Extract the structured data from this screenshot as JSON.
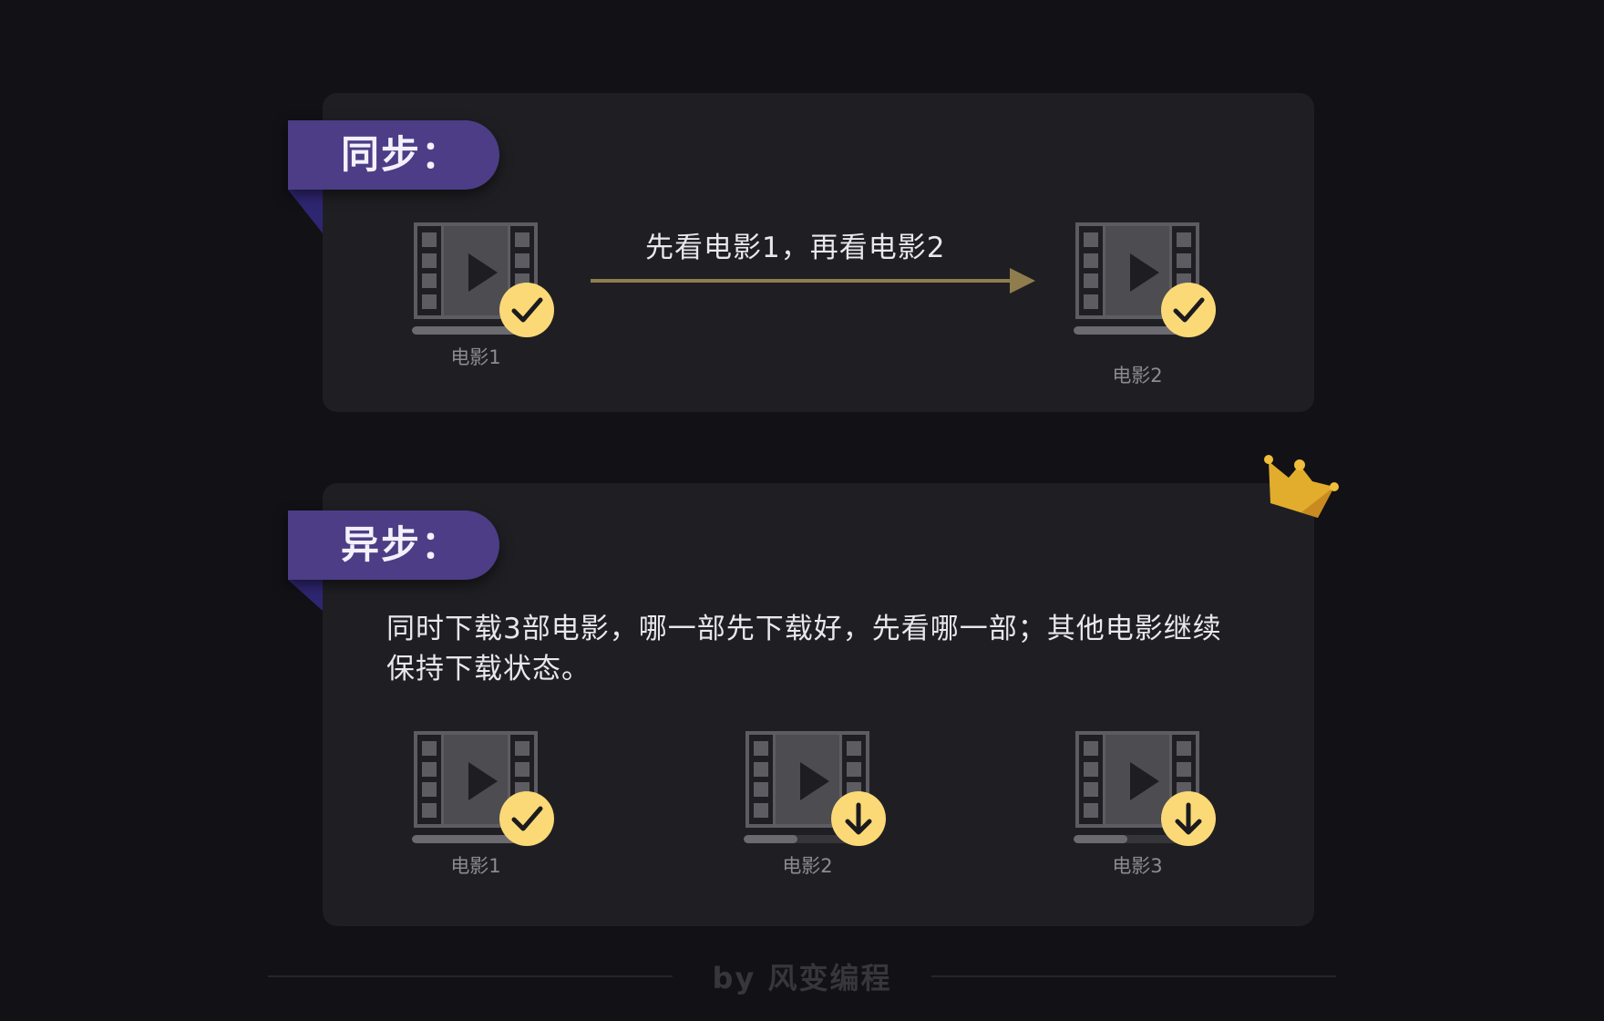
{
  "sync": {
    "heading": "同步：",
    "arrow_text": "先看电影1，再看电影2",
    "movies": [
      {
        "label": "电影1",
        "status": "done",
        "progress": 1.0
      },
      {
        "label": "电影2",
        "status": "done",
        "progress": 1.0
      }
    ]
  },
  "async": {
    "heading": "异步：",
    "description": "同时下载3部电影，哪一部先下载好，先看哪一部；其他电影继续保持下载状态。",
    "movies": [
      {
        "label": "电影1",
        "status": "done",
        "progress": 1.0
      },
      {
        "label": "电影2",
        "status": "downloading",
        "progress": 0.45
      },
      {
        "label": "电影3",
        "status": "downloading",
        "progress": 0.45
      }
    ]
  },
  "icons": {
    "movie": "film-reel-icon",
    "done": "checkmark-icon",
    "downloading": "download-arrow-icon",
    "decoration": "crown-icon"
  },
  "colors": {
    "background": "#111116",
    "card": "#1f1f23",
    "ribbon": "#4c3d86",
    "badge": "#fbd977",
    "arrow": "#8f7d4d",
    "crown": "#e2ad2c"
  },
  "footer": {
    "text": "by 风变编程"
  }
}
